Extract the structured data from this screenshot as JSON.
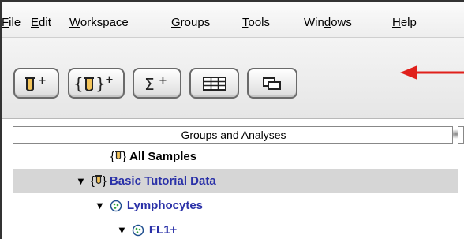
{
  "menubar": {
    "items": [
      {
        "label": "File",
        "accel": "F",
        "rest": "ile"
      },
      {
        "label": "Edit",
        "accel": "E",
        "rest": "dit"
      },
      {
        "label": "Workspace",
        "accel": "W",
        "rest": "orkspace"
      },
      {
        "label": "Groups",
        "accel": "G",
        "rest": "roups"
      },
      {
        "label": "Tools",
        "accel": "T",
        "rest": "ools"
      },
      {
        "label": "Windows",
        "pre": "Win",
        "accel": "d",
        "rest": "ows"
      },
      {
        "label": "Help",
        "accel": "H",
        "rest": "elp"
      }
    ]
  },
  "toolbar": {
    "buttons": [
      {
        "icon": "add-sample-tube-icon"
      },
      {
        "icon": "add-group-icon"
      },
      {
        "icon": "add-statistic-icon"
      },
      {
        "icon": "table-editor-icon"
      },
      {
        "icon": "layout-editor-icon"
      }
    ],
    "annotation": {
      "icon": "red-arrow-icon",
      "color": "#e0201b"
    }
  },
  "table": {
    "header": "Groups and Analyses",
    "rows": [
      {
        "label": "All Samples",
        "selected": false,
        "expanded": false,
        "kind": "group",
        "color": "#000000"
      },
      {
        "label": "Basic Tutorial Data",
        "selected": true,
        "expanded": true,
        "kind": "group",
        "color": "#2a31a8"
      },
      {
        "label": "Lymphocytes",
        "selected": false,
        "expanded": true,
        "kind": "gate",
        "color": "#2a31a8"
      },
      {
        "label": "FL1+",
        "selected": false,
        "expanded": true,
        "kind": "gate",
        "color": "#2a31a8"
      }
    ]
  },
  "colors": {
    "accent_blue": "#2a31a8",
    "selection": "#d6d6d6",
    "arrow": "#e0201b"
  }
}
